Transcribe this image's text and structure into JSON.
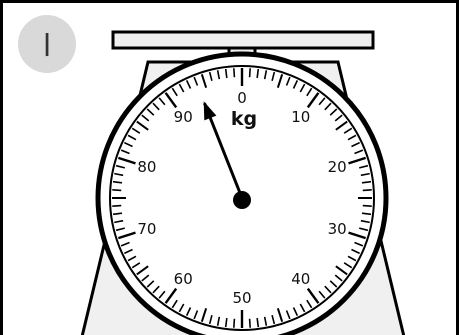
{
  "question_label": "l",
  "dial": {
    "unit": "kg",
    "min": 0,
    "max": 100,
    "major_labels": [
      "0",
      "10",
      "20",
      "30",
      "40",
      "50",
      "60",
      "70",
      "80",
      "90"
    ],
    "minor_per_major": 10,
    "reading_kg": 94
  },
  "colors": {
    "outline": "#000000",
    "badge_fill": "#d9d9d9",
    "face_fill": "#ffffff",
    "body_fill": "#f0f0f0"
  }
}
